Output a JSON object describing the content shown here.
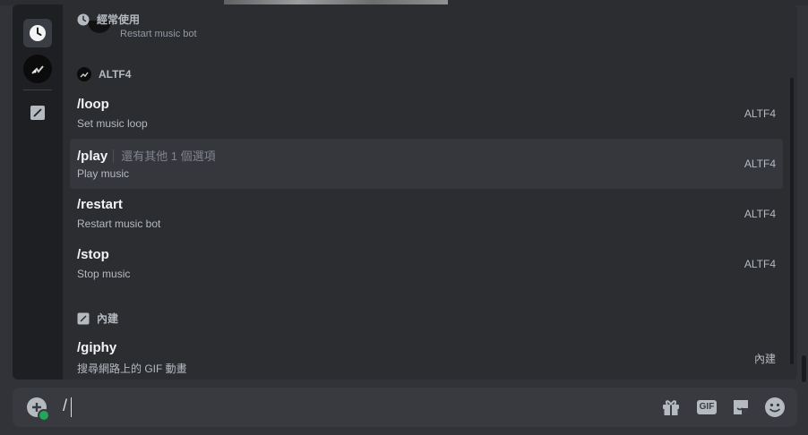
{
  "sections": {
    "frequent_label": "經常使用",
    "bot_label": "ALTF4",
    "builtin_label": "內建"
  },
  "peek_text": "Restart music bot",
  "commands": [
    {
      "name": "/loop",
      "desc": "Set music loop",
      "source": "ALTF4"
    },
    {
      "name": "/play",
      "more": "還有其他 1 個選項",
      "desc": "Play music",
      "source": "ALTF4"
    },
    {
      "name": "/restart",
      "desc": "Restart music bot",
      "source": "ALTF4"
    },
    {
      "name": "/stop",
      "desc": "Stop music",
      "source": "ALTF4"
    }
  ],
  "builtin_commands": [
    {
      "name": "/giphy",
      "desc": "搜尋網路上的 GIF 動畫",
      "source": "內建"
    }
  ],
  "input": {
    "value": "/"
  },
  "toolbar": {
    "gif_label": "GIF"
  },
  "colors": {
    "selected": "#36373d",
    "accent_green": "#23a55a",
    "popup_bg": "#2b2d31",
    "rail_bg": "#1e1f22"
  }
}
